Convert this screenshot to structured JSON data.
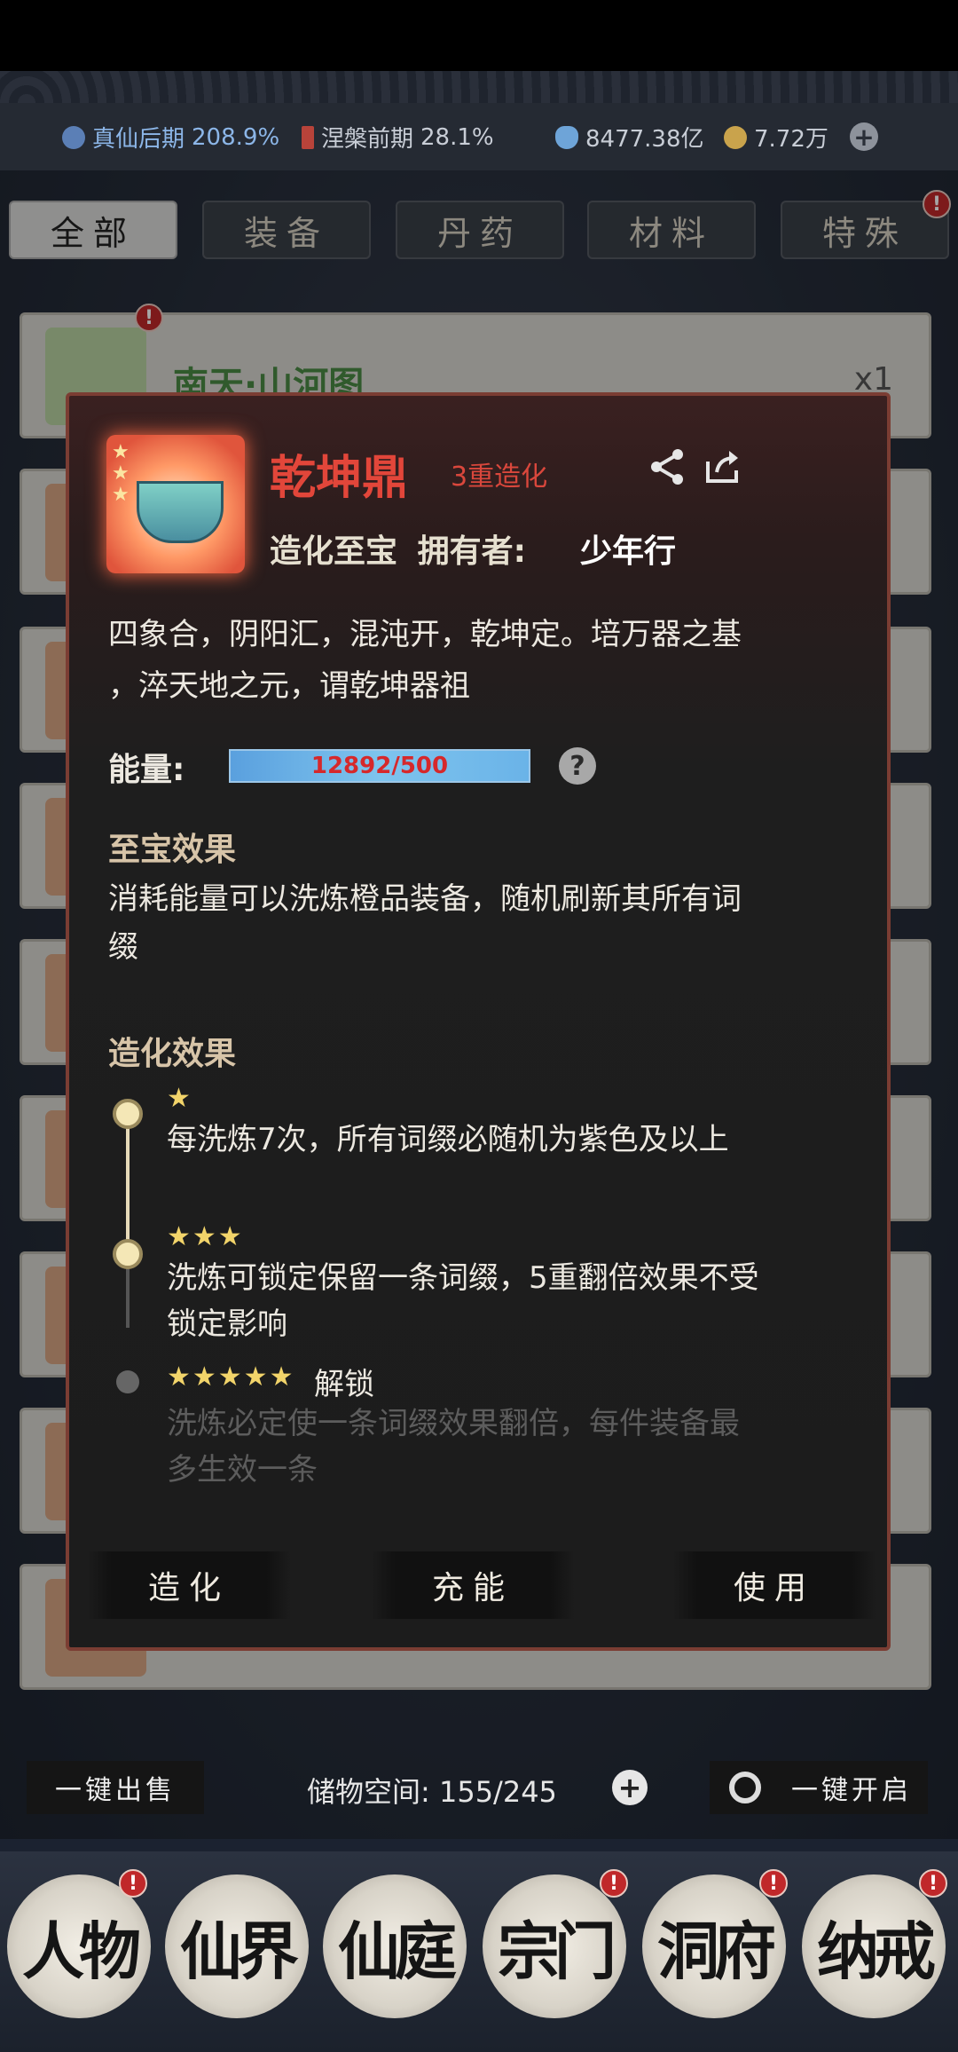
{
  "status": {
    "realm1_name": "真仙后期",
    "realm1_pct": "208.9%",
    "realm2_name": "涅槃前期",
    "realm2_pct": "28.1%",
    "spirit_stones": "8477.38亿",
    "coins": "7.72万"
  },
  "tabs": [
    "全部",
    "装备",
    "丹药",
    "材料",
    "特殊"
  ],
  "list": {
    "first_item_name": "南天·山河图",
    "first_item_qty": "x1"
  },
  "modal": {
    "title": "乾坤鼎",
    "refine_level": "3重造化",
    "type": "造化至宝",
    "owner_label": "拥有者:",
    "owner": "少年行",
    "desc_line1": "四象合，阴阳汇，混沌开，乾坤定。培万器之基",
    "desc_line2": "，淬天地之元，谓乾坤器祖",
    "energy_label": "能量:",
    "energy_value": "12892/500",
    "help": "?",
    "effect_title": "至宝效果",
    "effect_line1": "消耗能量可以洗炼橙品装备，随机刷新其所有词",
    "effect_line2": "缀",
    "refine_title": "造化效果",
    "levels": [
      {
        "stars": "★",
        "line1": "每洗炼7次，所有词缀必随机为紫色及以上",
        "line2": ""
      },
      {
        "stars": "★★★",
        "line1": "洗炼可锁定保留一条词缀，5重翻倍效果不受",
        "line2": "锁定影响"
      },
      {
        "stars": "★★★★★",
        "line1": "洗炼必定使一条词缀效果翻倍，每件装备最",
        "line2": "多生效一条"
      }
    ],
    "unlock_label": "解锁",
    "buttons": {
      "refine": "造化",
      "charge": "充能",
      "use": "使用"
    }
  },
  "bottom": {
    "sell_all": "一键出售",
    "storage_label": "储物空间:",
    "storage_value": "155/245",
    "open_all": "一键开启"
  },
  "nav": [
    "人物",
    "仙界",
    "仙庭",
    "宗门",
    "洞府",
    "纳戒"
  ],
  "badge": "!",
  "colors": {
    "title_red": "#e2463a",
    "energy_blue": "#6ab3e8",
    "star_gold": "#f2d46a"
  }
}
